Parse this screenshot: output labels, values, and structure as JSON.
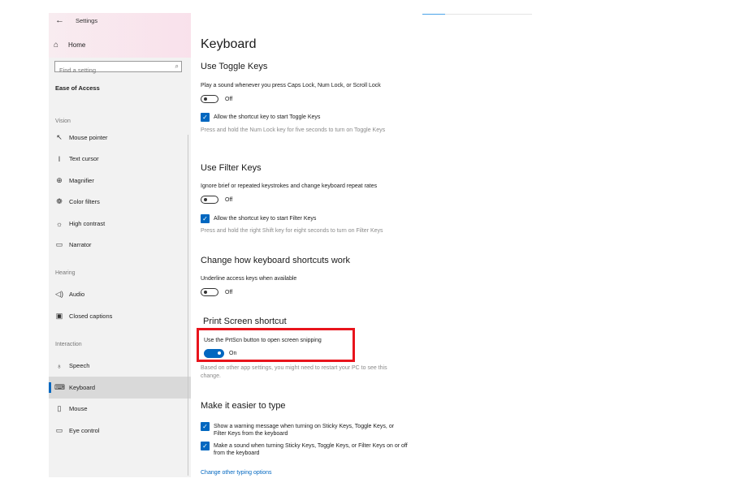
{
  "window": {
    "title": "Settings"
  },
  "sidebar": {
    "home": "Home",
    "search_placeholder": "Find a setting",
    "section_title": "Ease of Access",
    "groups": {
      "vision": "Vision",
      "hearing": "Hearing",
      "interaction": "Interaction"
    },
    "items": [
      {
        "label": "Mouse pointer",
        "icon": "mouse-pointer-icon"
      },
      {
        "label": "Text cursor",
        "icon": "text-cursor-icon"
      },
      {
        "label": "Magnifier",
        "icon": "magnifier-icon"
      },
      {
        "label": "Color filters",
        "icon": "color-filters-icon"
      },
      {
        "label": "High contrast",
        "icon": "high-contrast-icon"
      },
      {
        "label": "Narrator",
        "icon": "narrator-icon"
      },
      {
        "label": "Audio",
        "icon": "audio-icon"
      },
      {
        "label": "Closed captions",
        "icon": "closed-captions-icon"
      },
      {
        "label": "Speech",
        "icon": "speech-icon"
      },
      {
        "label": "Keyboard",
        "icon": "keyboard-icon",
        "active": true
      },
      {
        "label": "Mouse",
        "icon": "mouse-icon"
      },
      {
        "label": "Eye control",
        "icon": "eye-control-icon"
      }
    ]
  },
  "main": {
    "title": "Keyboard",
    "toggle_keys": {
      "heading": "Use Toggle Keys",
      "description": "Play a sound whenever you press Caps Lock, Num Lock, or Scroll Lock",
      "toggle_state": "Off",
      "checkbox_label": "Allow the shortcut key to start Toggle Keys",
      "help": "Press and hold the Num Lock key for five seconds to turn on Toggle Keys"
    },
    "filter_keys": {
      "heading": "Use Filter Keys",
      "description": "Ignore brief or repeated keystrokes and change keyboard repeat rates",
      "toggle_state": "Off",
      "checkbox_label": "Allow the shortcut key to start Filter Keys",
      "help": "Press and hold the right Shift key for eight seconds to turn on Filter Keys"
    },
    "shortcuts": {
      "heading": "Change how keyboard shortcuts work",
      "description": "Underline access keys when available",
      "toggle_state": "Off"
    },
    "print_screen": {
      "heading": "Print Screen shortcut",
      "description": "Use the PrtScn button to open screen snipping",
      "toggle_state": "On",
      "help": "Based on other app settings, you might need to restart your PC to see this change."
    },
    "typing": {
      "heading": "Make it easier to type",
      "checkbox1": "Show a warning message when turning on Sticky Keys, Toggle Keys, or Filter Keys from the keyboard",
      "checkbox2": "Make a sound when turning Sticky Keys, Toggle Keys, or Filter Keys on or off from the keyboard",
      "link": "Change other typing options"
    }
  },
  "colors": {
    "accent": "#0067c0",
    "highlight": "#e8141c",
    "sidebar_bg": "#f2f2f2"
  }
}
